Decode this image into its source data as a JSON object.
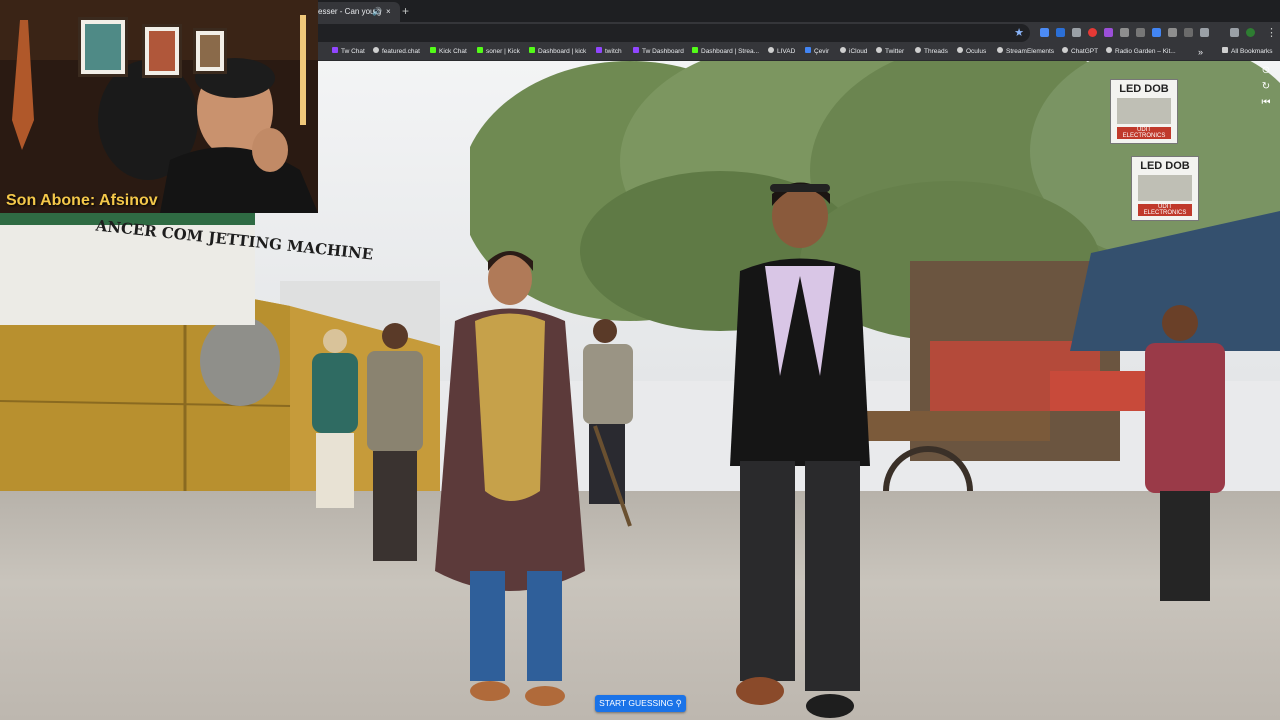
{
  "browser": {
    "tab_title": "esser - Can you g",
    "tab_audio_icon": "speaker-icon",
    "tab_close": "×",
    "new_tab": "+",
    "star": "★",
    "menu": "⋮"
  },
  "bookmarks": [
    {
      "label": "Tw Chat",
      "color": "#9146ff"
    },
    {
      "label": "featured.chat",
      "color": "#cfcfcf"
    },
    {
      "label": "Kick Chat",
      "color": "#53fc18"
    },
    {
      "label": "soner | Kick",
      "color": "#53fc18"
    },
    {
      "label": "Dashboard | kick",
      "color": "#53fc18"
    },
    {
      "label": "twitch",
      "color": "#9146ff"
    },
    {
      "label": "Tw Dashboard",
      "color": "#9146ff"
    },
    {
      "label": "Dashboard | Strea...",
      "color": "#53fc18"
    },
    {
      "label": "LIVAD",
      "color": "#cfcfcf"
    },
    {
      "label": "Çevir",
      "color": "#4285f4"
    },
    {
      "label": "iCloud",
      "color": "#cfcfcf"
    },
    {
      "label": "Twitter",
      "color": "#cfcfcf"
    },
    {
      "label": "Threads",
      "color": "#cfcfcf"
    },
    {
      "label": "Oculus",
      "color": "#cfcfcf"
    },
    {
      "label": "StreamElements",
      "color": "#cfcfcf"
    },
    {
      "label": "ChatGPT",
      "color": "#cfcfcf"
    },
    {
      "label": "Radio Garden – Kit...",
      "color": "#cfcfcf"
    },
    {
      "label": "»",
      "color": ""
    },
    {
      "label": "All Bookmarks",
      "color": "#cfcfcf"
    }
  ],
  "webcam": {
    "caption": "Son Abone: Afsinov"
  },
  "scene": {
    "factory_sign": "ANCER COM JETTING MACHINE",
    "sign1_title": "LED DOB",
    "sign1_footer": "UDIT ELECTRONICS",
    "sign2_title": "LED DOB",
    "sign2_footer": "UDIT ELECTRONICS"
  },
  "game": {
    "start_button": "START GUESSING ⚲",
    "side_controls": [
      "⊙",
      "↻",
      "⏮"
    ]
  }
}
